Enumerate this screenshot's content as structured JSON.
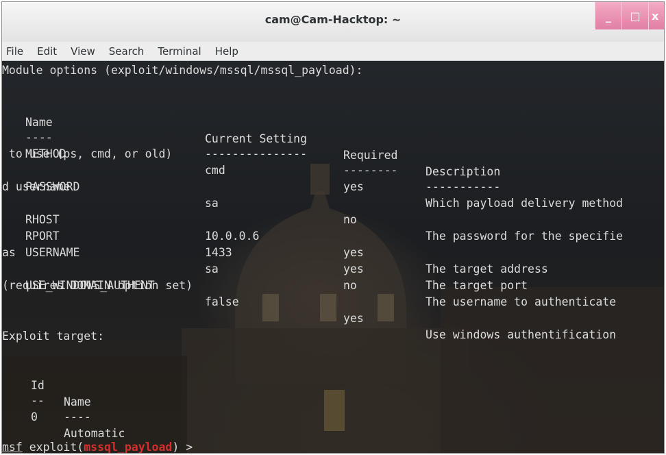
{
  "window": {
    "title": "cam@Cam-Hacktop: ~",
    "controls": [
      "_",
      "□",
      "x"
    ]
  },
  "menubar": [
    "File",
    "Edit",
    "View",
    "Search",
    "Terminal",
    "Help"
  ],
  "terminal": {
    "module_header": "Module options (exploit/windows/mssql/mssql_payload):",
    "options_headers": [
      "Name",
      "Current Setting",
      "Required",
      "Description"
    ],
    "options_underlines": [
      "----",
      "---------------",
      "--------",
      "-----------"
    ],
    "options": [
      {
        "name": "METHOD",
        "setting": "cmd",
        "required": "yes",
        "description": "Which payload delivery method",
        "wrap": " to use (ps, cmd, or old)"
      },
      {
        "name": "PASSWORD",
        "setting": "sa",
        "required": "no",
        "description": "The password for the specifie",
        "wrap": "d username"
      },
      {
        "name": "RHOST",
        "setting": "10.0.0.6",
        "required": "yes",
        "description": "The target address",
        "wrap": ""
      },
      {
        "name": "RPORT",
        "setting": "1433",
        "required": "yes",
        "description": "The target port",
        "wrap": ""
      },
      {
        "name": "USERNAME",
        "setting": "sa",
        "required": "no",
        "description": "The username to authenticate",
        "wrap": "as"
      },
      {
        "name": "USE_WINDOWS_AUTHENT",
        "setting": "false",
        "required": "yes",
        "description": "Use windows authentification",
        "wrap": "(requires DOMAIN option set)"
      }
    ],
    "target_header": "Exploit target:",
    "target_headers": [
      "Id",
      "Name"
    ],
    "target_underlines": [
      "--",
      "----"
    ],
    "targets": [
      {
        "id": "0",
        "name": "Automatic"
      }
    ],
    "prompt": {
      "msf": "msf",
      "middle": " exploit(",
      "module": "mssql_payload",
      "end": ") >"
    }
  },
  "colors": {
    "text": "#dcdcdc",
    "module_red": "#d62f2f",
    "control_pink": "#e88bb0"
  }
}
